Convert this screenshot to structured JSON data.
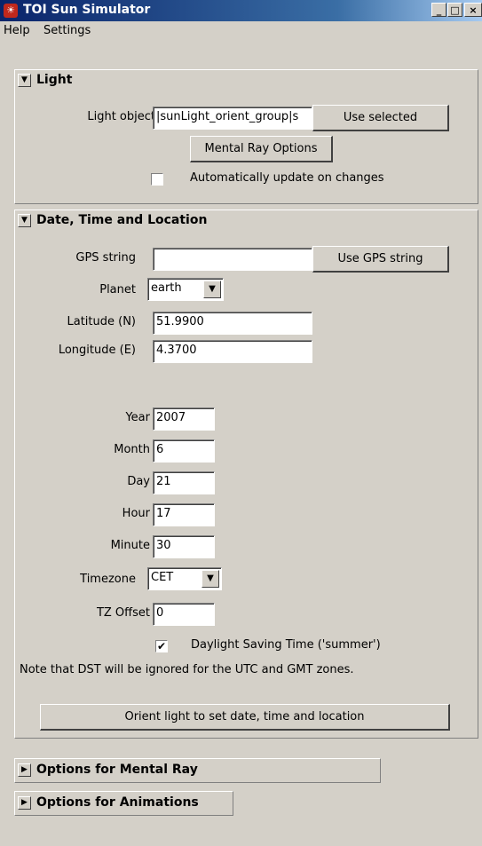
{
  "window": {
    "title": "TOI Sun Simulator",
    "minimize": "_",
    "maximize": "□",
    "close": "×"
  },
  "menu": [
    "Help",
    "Settings"
  ],
  "light": {
    "title": "Light",
    "object_label": "Light object",
    "object_value": "|sunLight_orient_group|s",
    "use_selected": "Use selected",
    "mental_ray_button": "Mental Ray Options",
    "auto_update_label": "Automatically update on changes",
    "auto_update_checked": false
  },
  "dtl": {
    "title": "Date, Time and Location",
    "gps_label": "GPS string",
    "gps_value": "",
    "use_gps": "Use GPS string",
    "planet_label": "Planet",
    "planet_value": "earth",
    "lat_label": "Latitude (N)",
    "lat_value": "51.9900",
    "lon_label": "Longitude (E)",
    "lon_value": "4.3700",
    "year_label": "Year",
    "year_value": "2007",
    "month_label": "Month",
    "month_value": "6",
    "day_label": "Day",
    "day_value": "21",
    "hour_label": "Hour",
    "hour_value": "17",
    "minute_label": "Minute",
    "minute_value": "30",
    "tz_label": "Timezone",
    "tz_value": "CET",
    "tzoff_label": "TZ Offset",
    "tzoff_value": "0",
    "dst_label": "Daylight Saving Time ('summer')",
    "dst_checked": true,
    "note": "Note that DST will be ignored for the UTC and GMT zones.",
    "orient_button": "Orient light to set date, time and location"
  },
  "mental_ray_section": "Options for Mental Ray",
  "animations_section": "Options for Animations",
  "icons": {
    "expanded": "▼",
    "collapsed": "▶",
    "dropdown": "▼",
    "check": "✔"
  }
}
